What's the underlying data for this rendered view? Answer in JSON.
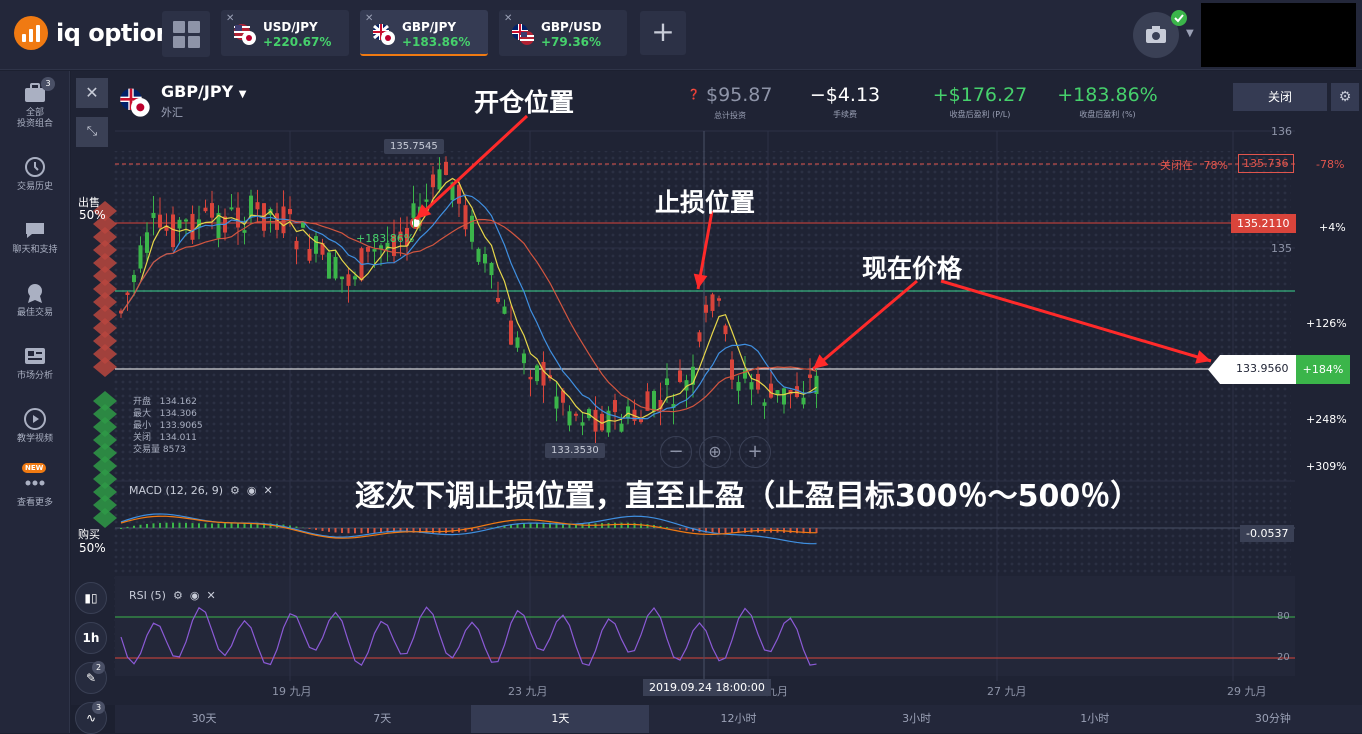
{
  "app": {
    "logo_text": "iq option"
  },
  "tabs": [
    {
      "name": "USD/JPY",
      "pct": "+220.67%"
    },
    {
      "name": "GBP/JPY",
      "pct": "+183.86%"
    },
    {
      "name": "GBP/USD",
      "pct": "+79.36%"
    }
  ],
  "sidebar": [
    {
      "label": "全部\n投资组合",
      "badge": "3"
    },
    {
      "label": "交易历史"
    },
    {
      "label": "聊天和支持"
    },
    {
      "label": "最佳交易"
    },
    {
      "label": "市场分析"
    },
    {
      "label": "教学视频"
    },
    {
      "label": "查看更多",
      "badge": "NEW"
    }
  ],
  "asset": {
    "name": "GBP/JPY",
    "type": "外汇"
  },
  "stats": [
    {
      "value": "$95.87",
      "label": "总计投资"
    },
    {
      "value": "−$4.13",
      "label": "手续费"
    },
    {
      "value": "+$176.27",
      "label": "收盘后盈利 (P/L)"
    },
    {
      "value": "+183.86%",
      "label": "收盘后盈利 (%)"
    }
  ],
  "close_button": "关闭",
  "sell": {
    "label": "出售",
    "pct": "50%"
  },
  "buy": {
    "label": "购买",
    "pct": "50%"
  },
  "annotations": {
    "open": "开仓位置",
    "stop": "止损位置",
    "current": "现在价格",
    "bottom": "逐次下调止损位置，直至止盈（止盈目标300％～500％）"
  },
  "price_labels": {
    "high": "135.7545",
    "low": "133.3530",
    "entry_profit": "+183.86%",
    "close_at": "关闭在",
    "close_at_pct": "78%",
    "close_at_price": "135.736",
    "red_line": "135.2110",
    "current": "133.9560",
    "current_pct": "+184%",
    "macd_val": "-0.0537"
  },
  "right_labels": [
    "-78%",
    "+4%",
    "+126%",
    "+248%",
    "+309%"
  ],
  "price_ticks": [
    "136",
    "135"
  ],
  "rsi_ticks": [
    "80",
    "20"
  ],
  "ohlc": {
    "labels": [
      "开盘",
      "最大",
      "最小",
      "关闭",
      "交易量"
    ],
    "values": [
      "134.162",
      "134.306",
      "133.9065",
      "134.011",
      "8573"
    ]
  },
  "indicators": {
    "macd": "MACD (12, 26, 9)",
    "rsi": "RSI (5)"
  },
  "time_axis": [
    "19 九月",
    "23 九月",
    "九月",
    "27 九月",
    "29 九月"
  ],
  "time_cursor": "2019.09.24 18:00:00",
  "timeframes": [
    "30天",
    "7天",
    "1天",
    "12小时",
    "3小时",
    "1小时",
    "30分钟"
  ],
  "active_timeframe": "1天",
  "tools": {
    "interval": "1h",
    "draw_badge": "2",
    "ind_badge": "3"
  }
}
